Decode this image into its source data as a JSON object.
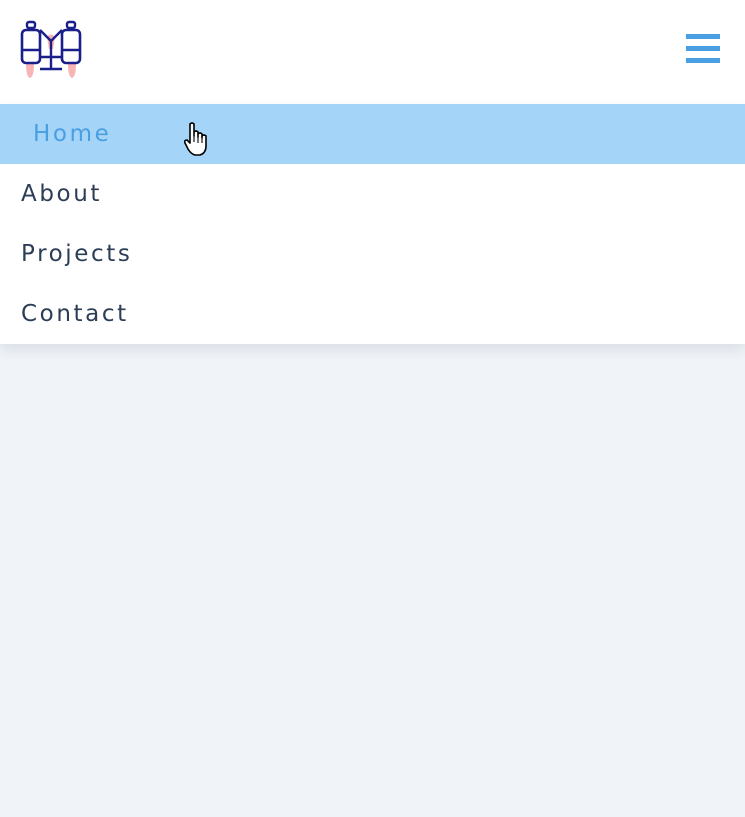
{
  "header": {
    "logo_icon": "jetpack-icon",
    "menu_icon": "hamburger-menu-icon"
  },
  "nav": {
    "items": [
      {
        "label": "Home",
        "active": true
      },
      {
        "label": "About",
        "active": false
      },
      {
        "label": "Projects",
        "active": false
      },
      {
        "label": "Contact",
        "active": false
      }
    ]
  },
  "pointer": "hand-cursor-icon",
  "colors": {
    "accent": "#4a9fe3",
    "active_bg": "#a4d4f7",
    "text": "#2c3e55",
    "page_bg": "#f0f4f8",
    "logo_outline": "#1a1f8a",
    "logo_flame": "#f7b4b4"
  }
}
